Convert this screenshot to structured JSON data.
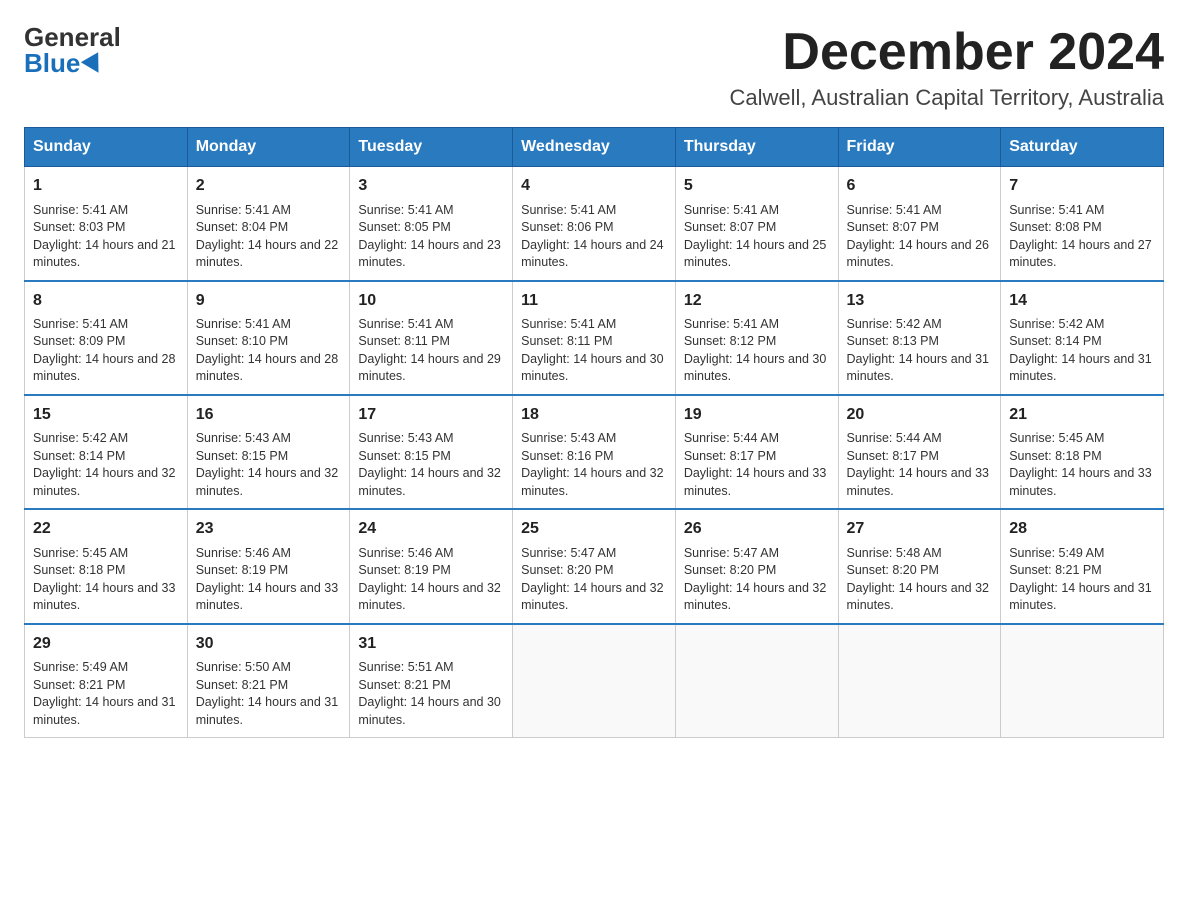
{
  "logo": {
    "general": "General",
    "blue": "Blue"
  },
  "title": "December 2024",
  "location": "Calwell, Australian Capital Territory, Australia",
  "days_of_week": [
    "Sunday",
    "Monday",
    "Tuesday",
    "Wednesday",
    "Thursday",
    "Friday",
    "Saturday"
  ],
  "weeks": [
    [
      {
        "day": "1",
        "sunrise": "5:41 AM",
        "sunset": "8:03 PM",
        "daylight": "14 hours and 21 minutes."
      },
      {
        "day": "2",
        "sunrise": "5:41 AM",
        "sunset": "8:04 PM",
        "daylight": "14 hours and 22 minutes."
      },
      {
        "day": "3",
        "sunrise": "5:41 AM",
        "sunset": "8:05 PM",
        "daylight": "14 hours and 23 minutes."
      },
      {
        "day": "4",
        "sunrise": "5:41 AM",
        "sunset": "8:06 PM",
        "daylight": "14 hours and 24 minutes."
      },
      {
        "day": "5",
        "sunrise": "5:41 AM",
        "sunset": "8:07 PM",
        "daylight": "14 hours and 25 minutes."
      },
      {
        "day": "6",
        "sunrise": "5:41 AM",
        "sunset": "8:07 PM",
        "daylight": "14 hours and 26 minutes."
      },
      {
        "day": "7",
        "sunrise": "5:41 AM",
        "sunset": "8:08 PM",
        "daylight": "14 hours and 27 minutes."
      }
    ],
    [
      {
        "day": "8",
        "sunrise": "5:41 AM",
        "sunset": "8:09 PM",
        "daylight": "14 hours and 28 minutes."
      },
      {
        "day": "9",
        "sunrise": "5:41 AM",
        "sunset": "8:10 PM",
        "daylight": "14 hours and 28 minutes."
      },
      {
        "day": "10",
        "sunrise": "5:41 AM",
        "sunset": "8:11 PM",
        "daylight": "14 hours and 29 minutes."
      },
      {
        "day": "11",
        "sunrise": "5:41 AM",
        "sunset": "8:11 PM",
        "daylight": "14 hours and 30 minutes."
      },
      {
        "day": "12",
        "sunrise": "5:41 AM",
        "sunset": "8:12 PM",
        "daylight": "14 hours and 30 minutes."
      },
      {
        "day": "13",
        "sunrise": "5:42 AM",
        "sunset": "8:13 PM",
        "daylight": "14 hours and 31 minutes."
      },
      {
        "day": "14",
        "sunrise": "5:42 AM",
        "sunset": "8:14 PM",
        "daylight": "14 hours and 31 minutes."
      }
    ],
    [
      {
        "day": "15",
        "sunrise": "5:42 AM",
        "sunset": "8:14 PM",
        "daylight": "14 hours and 32 minutes."
      },
      {
        "day": "16",
        "sunrise": "5:43 AM",
        "sunset": "8:15 PM",
        "daylight": "14 hours and 32 minutes."
      },
      {
        "day": "17",
        "sunrise": "5:43 AM",
        "sunset": "8:15 PM",
        "daylight": "14 hours and 32 minutes."
      },
      {
        "day": "18",
        "sunrise": "5:43 AM",
        "sunset": "8:16 PM",
        "daylight": "14 hours and 32 minutes."
      },
      {
        "day": "19",
        "sunrise": "5:44 AM",
        "sunset": "8:17 PM",
        "daylight": "14 hours and 33 minutes."
      },
      {
        "day": "20",
        "sunrise": "5:44 AM",
        "sunset": "8:17 PM",
        "daylight": "14 hours and 33 minutes."
      },
      {
        "day": "21",
        "sunrise": "5:45 AM",
        "sunset": "8:18 PM",
        "daylight": "14 hours and 33 minutes."
      }
    ],
    [
      {
        "day": "22",
        "sunrise": "5:45 AM",
        "sunset": "8:18 PM",
        "daylight": "14 hours and 33 minutes."
      },
      {
        "day": "23",
        "sunrise": "5:46 AM",
        "sunset": "8:19 PM",
        "daylight": "14 hours and 33 minutes."
      },
      {
        "day": "24",
        "sunrise": "5:46 AM",
        "sunset": "8:19 PM",
        "daylight": "14 hours and 32 minutes."
      },
      {
        "day": "25",
        "sunrise": "5:47 AM",
        "sunset": "8:20 PM",
        "daylight": "14 hours and 32 minutes."
      },
      {
        "day": "26",
        "sunrise": "5:47 AM",
        "sunset": "8:20 PM",
        "daylight": "14 hours and 32 minutes."
      },
      {
        "day": "27",
        "sunrise": "5:48 AM",
        "sunset": "8:20 PM",
        "daylight": "14 hours and 32 minutes."
      },
      {
        "day": "28",
        "sunrise": "5:49 AM",
        "sunset": "8:21 PM",
        "daylight": "14 hours and 31 minutes."
      }
    ],
    [
      {
        "day": "29",
        "sunrise": "5:49 AM",
        "sunset": "8:21 PM",
        "daylight": "14 hours and 31 minutes."
      },
      {
        "day": "30",
        "sunrise": "5:50 AM",
        "sunset": "8:21 PM",
        "daylight": "14 hours and 31 minutes."
      },
      {
        "day": "31",
        "sunrise": "5:51 AM",
        "sunset": "8:21 PM",
        "daylight": "14 hours and 30 minutes."
      },
      null,
      null,
      null,
      null
    ]
  ]
}
